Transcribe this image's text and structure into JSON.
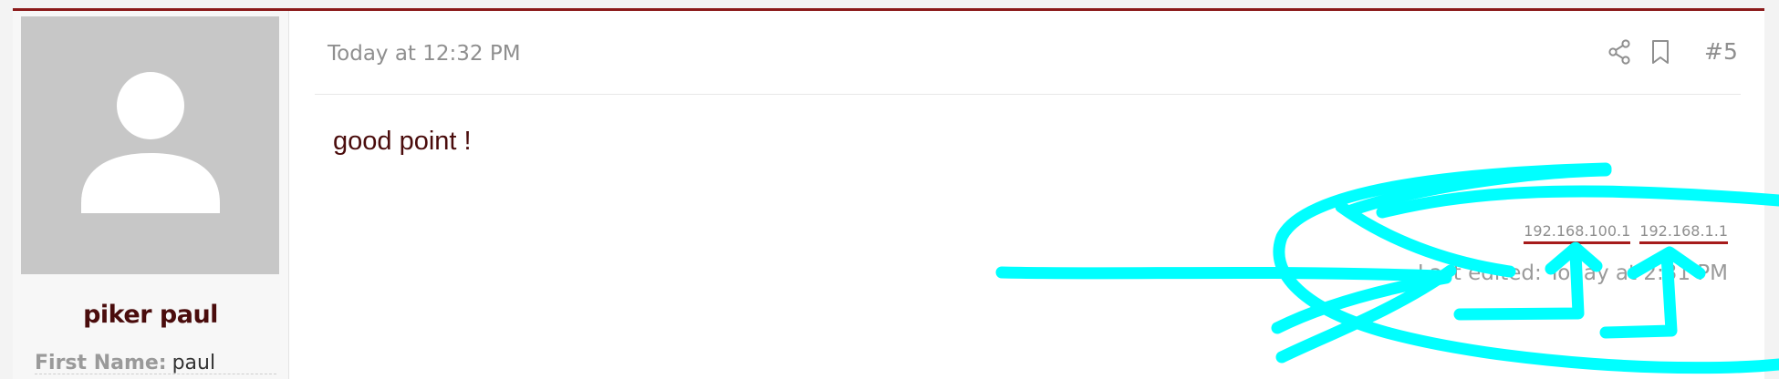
{
  "post": {
    "date": "Today at 12:32 PM",
    "number": "#5",
    "message": "good point !",
    "ip_links": [
      "192.168.100.1",
      "192.168.1.1"
    ],
    "last_edited": "Last edited: Today at 2:31 PM"
  },
  "user": {
    "name": "piker paul",
    "field_label": "First Name:",
    "field_value": "paul"
  },
  "icons": {
    "share": "share-icon",
    "bookmark": "bookmark-icon",
    "avatar": "default-avatar-icon"
  },
  "colors": {
    "accent": "#8b1a1a",
    "username": "#4a0c0c",
    "annotation": "#00ffff"
  }
}
